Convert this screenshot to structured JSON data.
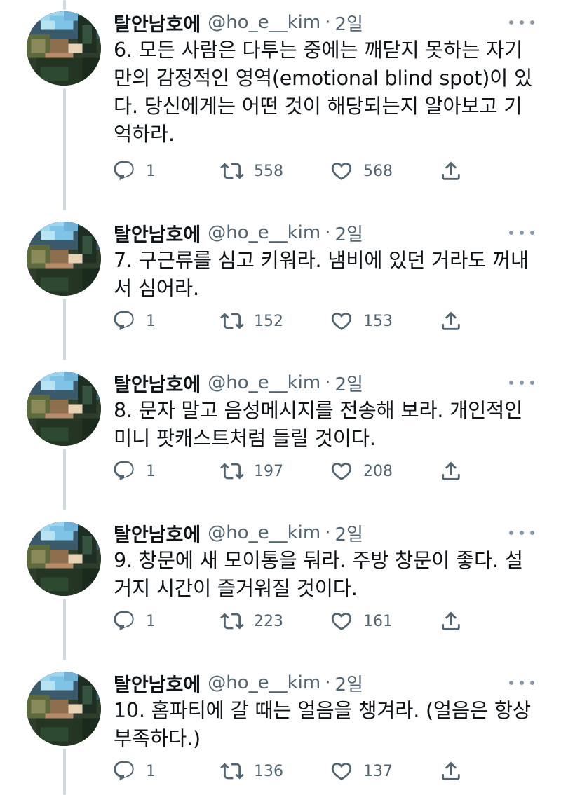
{
  "tweets": [
    {
      "name": "탈안남호에",
      "handle": "@ho_e__kim",
      "dot": "·",
      "time": "2일",
      "text": "6. 모든 사람은 다투는 중에는 깨닫지 못하는 자기\n만의 감정적인 영역(emotional blind spot)이 있\n다. 당신에게는 어떤 것이 해당되는지 알아보고 기\n억하라.",
      "replies": "1",
      "retweets": "558",
      "likes": "568"
    },
    {
      "name": "탈안남호에",
      "handle": "@ho_e__kim",
      "dot": "·",
      "time": "2일",
      "text": "7. 구근류를 심고 키워라. 냄비에 있던 거라도 꺼내\n서 심어라.",
      "replies": "1",
      "retweets": "152",
      "likes": "153"
    },
    {
      "name": "탈안남호에",
      "handle": "@ho_e__kim",
      "dot": "·",
      "time": "2일",
      "text": "8. 문자 말고 음성메시지를 전송해 보라. 개인적인\n미니 팟캐스트처럼 들릴 것이다.",
      "replies": "1",
      "retweets": "197",
      "likes": "208"
    },
    {
      "name": "탈안남호에",
      "handle": "@ho_e__kim",
      "dot": "·",
      "time": "2일",
      "text": "9. 창문에 새 모이통을 둬라. 주방 창문이 좋다. 설\n거지 시간이 즐거워질 것이다.",
      "replies": "1",
      "retweets": "223",
      "likes": "161"
    },
    {
      "name": "탈안남호에",
      "handle": "@ho_e__kim",
      "dot": "·",
      "time": "2일",
      "text": "10. 홈파티에 갈 때는 얼음을 챙겨라. (얼음은 항상\n부족하다.)",
      "replies": "1",
      "retweets": "136",
      "likes": "137"
    }
  ],
  "icons": {
    "reply": "reply-icon",
    "retweet": "retweet-icon",
    "like": "heart-icon",
    "share": "share-icon",
    "more": "more-icon"
  },
  "colors": {
    "text": "#0f1419",
    "secondary": "#536471",
    "thread_line": "#cfd9de",
    "icon": "#536471"
  }
}
